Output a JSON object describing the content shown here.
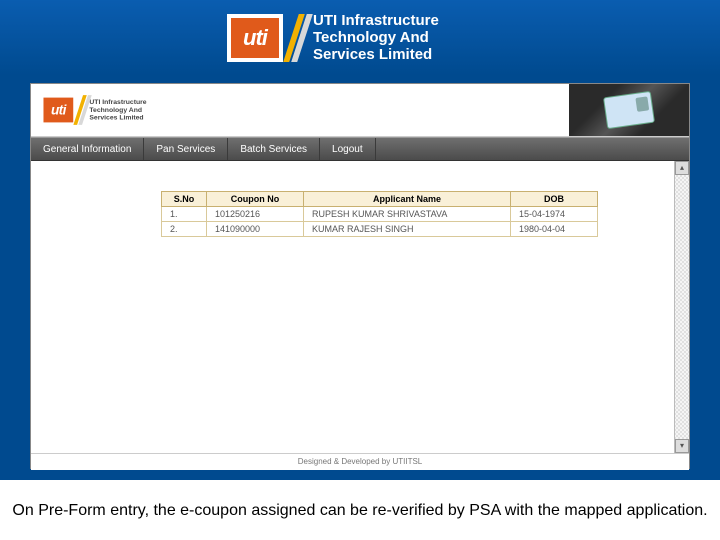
{
  "brand": {
    "short": "uti",
    "name_line1": "UTI Infrastructure",
    "name_line2": "Technology And",
    "name_line3": "Services Limited"
  },
  "menu": {
    "general": "General Information",
    "pan": "Pan Services",
    "batch": "Batch Services",
    "logout": "Logout"
  },
  "table": {
    "headers": {
      "sno": "S.No",
      "coupon": "Coupon No",
      "name": "Applicant Name",
      "dob": "DOB"
    },
    "rows": [
      {
        "sno": "1.",
        "coupon": "101250216",
        "name": "RUPESH KUMAR SHRIVASTAVA",
        "dob": "15-04-1974"
      },
      {
        "sno": "2.",
        "coupon": "141090000",
        "name": "KUMAR RAJESH SINGH",
        "dob": "1980-04-04"
      }
    ]
  },
  "footer": "Designed & Developed by UTIITSL",
  "caption": "On Pre-Form entry, the e-coupon assigned can be re-verified by PSA with the mapped application."
}
